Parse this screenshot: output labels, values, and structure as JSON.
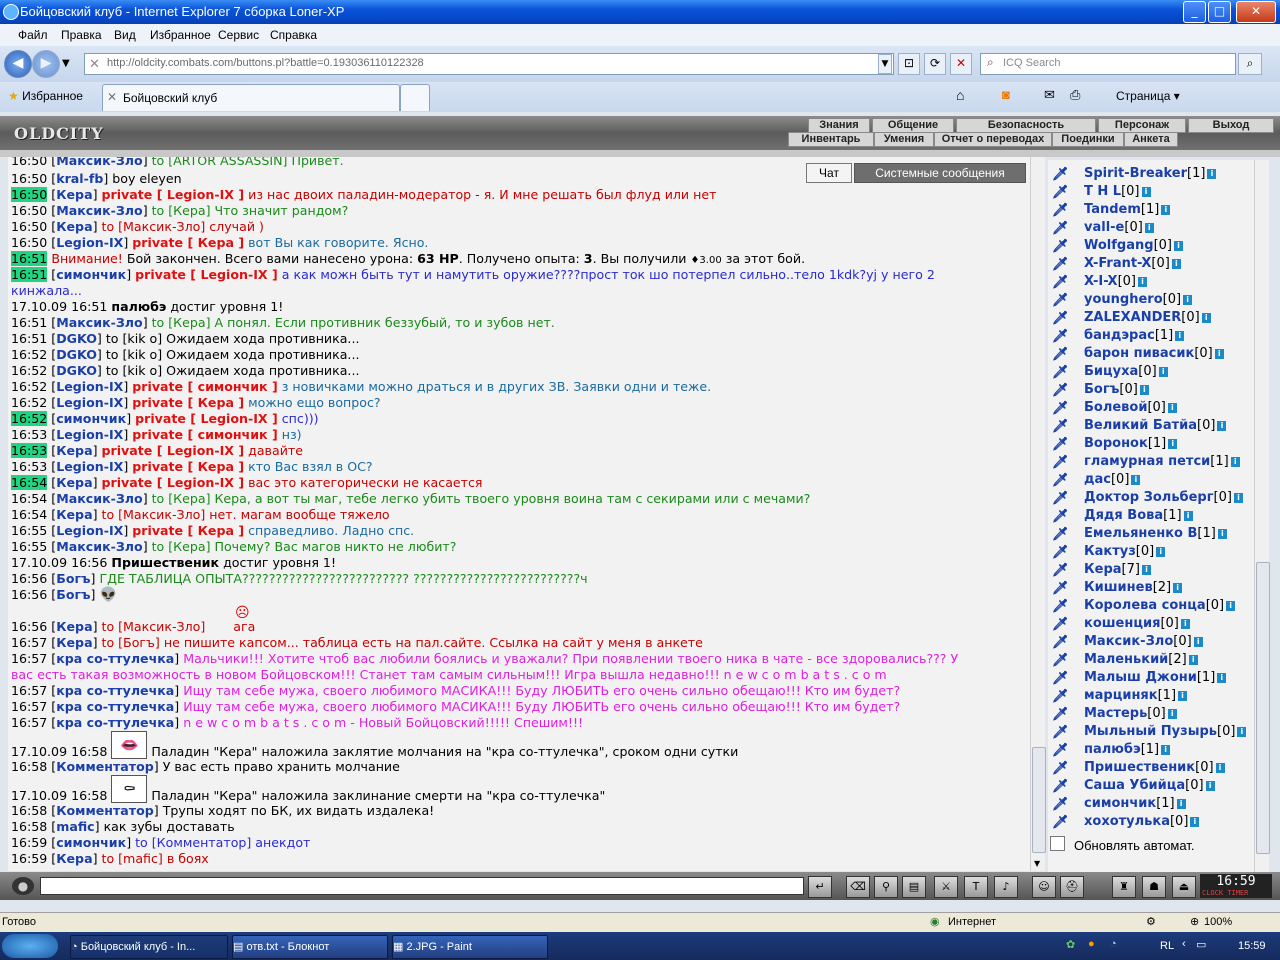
{
  "window": {
    "title": "Бойцовский клуб - Internet Explorer 7 сборка Loner-XP",
    "min": "_",
    "max": "□",
    "close": "✕"
  },
  "menu": [
    "Файл",
    "Правка",
    "Вид",
    "Избранное",
    "Сервис",
    "Справка"
  ],
  "address": {
    "url": "http://oldcity.combats.com/buttons.pl?battle=0.193036110122328",
    "search_placeholder": "ICQ Search"
  },
  "tabs": {
    "favorites": "Избранное",
    "active_tab": "Бойцовский клуб",
    "page_menu": "Страница ▾"
  },
  "game": {
    "logo": "OLDCITY",
    "menu_top": [
      "Знания",
      "Общение",
      "Безопасность",
      "Персонаж",
      "Выход"
    ],
    "menu_bottom": [
      "Инвентарь",
      "Умения",
      "Отчет о переводах",
      "Поединки",
      "Анкета"
    ]
  },
  "chat_tabs": {
    "chat": "Чат",
    "system": "Системные сообщения"
  },
  "chat": {
    "l00": {
      "t": "16:50",
      "n": "Максик-Зло",
      "to": "to [АRTOR ASSASSIN] Привет."
    },
    "l01": {
      "t": "16:50",
      "n": "kral-fb",
      "msg": " boy eleyen"
    },
    "l02": {
      "t": "16:50",
      "n": "Кера",
      "p": "private [ Legion-IX ]",
      "msg": " из нас двоих паладин-модератор - я. И мне решать был флуд или нет"
    },
    "l03": {
      "t": "16:50",
      "n": "Максик-Зло",
      "to": "to [Кера] Что значит рандом?"
    },
    "l04": {
      "t": "16:50",
      "n": "Кера",
      "to": "to [Максик-Зло] случай )"
    },
    "l05": {
      "t": "16:50",
      "n": "Legion-IX",
      "p": "private [ Кера ]",
      "msg": " вот Вы как говорите. Ясно."
    },
    "l06": {
      "t": "16:51",
      "warn": "Внимание!",
      "msg": " Бой закончен. Всего вами нанесено урона: ",
      "b1": "63 HP",
      "m2": ". Получено опыта: ",
      "b2": "3",
      "m3": ". Вы получили ",
      "sm": "♦3.00",
      "m4": " за этот бой."
    },
    "l07": {
      "t": "16:51",
      "n": "симончик",
      "p": "private [ Legion-IX ]",
      "msg": " а как можн быть тут и намутить оружие????прост ток шо потерпел сильно..тело 1kdk?yj у него 2"
    },
    "l07b": "кинжала...",
    "l08": {
      "t": "17.10.09 16:51",
      "who": "палюбэ",
      "msg": " достиг уровня 1!"
    },
    "l09": {
      "t": "16:51",
      "n": "Максик-Зло",
      "to": "to [Кера] А понял. Если противник беззубый, то и зубов нет."
    },
    "l10": {
      "t": "16:51",
      "n": "DGKO",
      "to": "to [kik o] Ожидаем хода противника..."
    },
    "l11": {
      "t": "16:52",
      "n": "DGKO",
      "to": "to [kik o] Ожидаем хода противника..."
    },
    "l12": {
      "t": "16:52",
      "n": "DGKO",
      "to": "to [kik o] Ожидаем хода противника..."
    },
    "l13": {
      "t": "16:52",
      "n": "Legion-IX",
      "p": "private [ симончик ]",
      "msg": " з новичками можно драться и в других ЗВ. Заявки одни и теже."
    },
    "l14": {
      "t": "16:52",
      "n": "Legion-IX",
      "p": "private [ Кера ]",
      "msg": " можно ещо вопрос?"
    },
    "l15": {
      "t": "16:52",
      "n": "симончик",
      "p": "private [ Legion-IX ]",
      "msg": " спс)))"
    },
    "l16": {
      "t": "16:53",
      "n": "Legion-IX",
      "p": "private [ симончик ]",
      "msg": " нз)"
    },
    "l17": {
      "t": "16:53",
      "n": "Кера",
      "p": "private [ Legion-IX ]",
      "msg": " давайте"
    },
    "l18": {
      "t": "16:53",
      "n": "Legion-IX",
      "p": "private [ Кера ]",
      "msg": " кто Вас взял в ОС?"
    },
    "l19": {
      "t": "16:54",
      "n": "Кера",
      "p": "private [ Legion-IX ]",
      "msg": " вас это категорически не касается"
    },
    "l20": {
      "t": "16:54",
      "n": "Максик-Зло",
      "to": "to [Кера] Кера, а вот ты маг, тебе легко убить твоего уровня воина там с секирами или с мечами?"
    },
    "l21": {
      "t": "16:54",
      "n": "Кера",
      "to": "to [Максик-Зло] нет. магам вообще тяжело"
    },
    "l22": {
      "t": "16:55",
      "n": "Legion-IX",
      "p": "private [ Кера ]",
      "msg": " справедливо. Ладно спс."
    },
    "l23": {
      "t": "16:55",
      "n": "Максик-Зло",
      "to": "to [Кера] Почему? Вас магов никто не любит?"
    },
    "l24": {
      "t": "17.10.09 16:56",
      "who": "Пришественик",
      "msg": " достиг уровня 1!"
    },
    "l25": {
      "t": "16:56",
      "n": "Богъ",
      "msg": " ГДЕ ТАБЛИЦА ОПЫТА????????????????????????? ?????????????????????????ч"
    },
    "l26": {
      "t": "16:56",
      "n": "Богъ",
      "msg": ""
    },
    "l27": {
      "t": "16:56",
      "n": "Кера",
      "to": "to [Максик-Зло]",
      "tail": " ага"
    },
    "l28": {
      "t": "16:57",
      "n": "Кера",
      "to": "to [Богъ] не пишите капсом... таблица есть на пал.сайте. Ссылка на сайт у меня в анкете"
    },
    "l29": {
      "t": "16:57",
      "n": "кра со-ттулечка",
      "msg": " Мальчики!!! Хотите чтоб вас любили боялись и уважали? При появлении твоего ника в чате - все здоровались??? У"
    },
    "l29b": "вас есть такая возможность в новом Бойцовском!!! Станет там самым сильным!!! Игра вышла недавно!!! n e w c o m b a t s . c o m",
    "l30": {
      "t": "16:57",
      "n": "кра со-ттулечка",
      "msg": " Ищу там себе мужа, своего любимого МАСИКА!!! Буду ЛЮБИТЬ его очень сильно обещаю!!! Кто им будет?"
    },
    "l31": {
      "t": "16:57",
      "n": "кра со-ттулечка",
      "msg": " Ищу там себе мужа, своего любимого МАСИКА!!! Буду ЛЮБИТЬ его очень сильно обещаю!!! Кто им будет?"
    },
    "l32": {
      "t": "16:57",
      "n": "кра со-ттулечка",
      "msg": " n e w c o m b a t s . c o m - Новый Бойцовский!!!!! Спешим!!!"
    },
    "l33": {
      "t": "17.10.09 16:58",
      "msg": " Паладин \"Кера\" наложила заклятие молчания на \"кра со-ттулечка\", сроком одни сутки"
    },
    "l34": {
      "t": "16:58",
      "n": "Комментатор",
      "msg": " У вас есть право хранить молчание"
    },
    "l35": {
      "t": "17.10.09 16:58",
      "msg": " Паладин \"Кера\" наложила заклинание смерти на \"кра со-ттулечка\""
    },
    "l36": {
      "t": "16:58",
      "n": "Комментатор",
      "msg": " Трупы ходят по БК, их видать издалека!"
    },
    "l37": {
      "t": "16:58",
      "n": "mafic",
      "msg": " как зубы доставать"
    },
    "l38": {
      "t": "16:59",
      "n": "симончик",
      "to": "to [Комментатор] анекдот"
    },
    "l39": {
      "t": "16:59",
      "n": "Кера",
      "to": "to [mafic] в боях"
    }
  },
  "users": [
    {
      "n": "Spirit-Breaker",
      "l": "[1]"
    },
    {
      "n": "T H L",
      "l": "[0]"
    },
    {
      "n": "Tandem",
      "l": "[1]"
    },
    {
      "n": "vall-e",
      "l": "[0]"
    },
    {
      "n": "Wolfgang",
      "l": "[0]"
    },
    {
      "n": "X-Frant-X",
      "l": "[0]"
    },
    {
      "n": "X-I-X",
      "l": "[0]"
    },
    {
      "n": "younghero",
      "l": "[0]"
    },
    {
      "n": "ZALEXANDER",
      "l": "[0]"
    },
    {
      "n": "бандэрас",
      "l": "[1]"
    },
    {
      "n": "барон пивасик",
      "l": "[0]"
    },
    {
      "n": "Бицуха",
      "l": "[0]"
    },
    {
      "n": "Богъ",
      "l": "[0]"
    },
    {
      "n": "Болевой",
      "l": "[0]"
    },
    {
      "n": "Великий Батйа",
      "l": "[0]"
    },
    {
      "n": "Воронок",
      "l": "[1]"
    },
    {
      "n": "гламурная петси",
      "l": "[1]"
    },
    {
      "n": "дас",
      "l": "[0]"
    },
    {
      "n": "Доктор Зольберг",
      "l": "[0]"
    },
    {
      "n": "Дядя Вова",
      "l": "[1]"
    },
    {
      "n": "Емельяненко В",
      "l": "[1]"
    },
    {
      "n": "Кактуз",
      "l": "[0]"
    },
    {
      "n": "Кера",
      "l": "[7]"
    },
    {
      "n": "Кишинев",
      "l": "[2]"
    },
    {
      "n": "Королева сонца",
      "l": "[0]"
    },
    {
      "n": "кошенция",
      "l": "[0]"
    },
    {
      "n": "Максик-Зло",
      "l": "[0]"
    },
    {
      "n": "Маленький",
      "l": "[2]"
    },
    {
      "n": "Малыш Джони",
      "l": "[1]"
    },
    {
      "n": "марциняк",
      "l": "[1]"
    },
    {
      "n": "Мастерь",
      "l": "[0]"
    },
    {
      "n": "Мыльный Пузырь",
      "l": "[0]"
    },
    {
      "n": "палюбэ",
      "l": "[1]"
    },
    {
      "n": "Пришественик",
      "l": "[0]"
    },
    {
      "n": "Саша Убийца",
      "l": "[0]"
    },
    {
      "n": "симончик",
      "l": "[1]"
    },
    {
      "n": "хохотулька",
      "l": "[0]"
    }
  ],
  "auto_refresh": "Обновлять автомат.",
  "clock": {
    "time": "16:59",
    "label": "CLOCK TIMER"
  },
  "status": {
    "left": "Готово",
    "zone": "Интернет",
    "zoom": "100%"
  },
  "taskbar": {
    "tasks": [
      "Бойцовский клуб - In...",
      "отв.txt - Блокнот",
      "2.JPG - Paint"
    ],
    "lang": "RL",
    "time": "15:59"
  },
  "colors": {
    "accent_green": "#22d482",
    "private": "#e01010",
    "nick": "#1a3fa8",
    "spam": "#e020e0"
  }
}
